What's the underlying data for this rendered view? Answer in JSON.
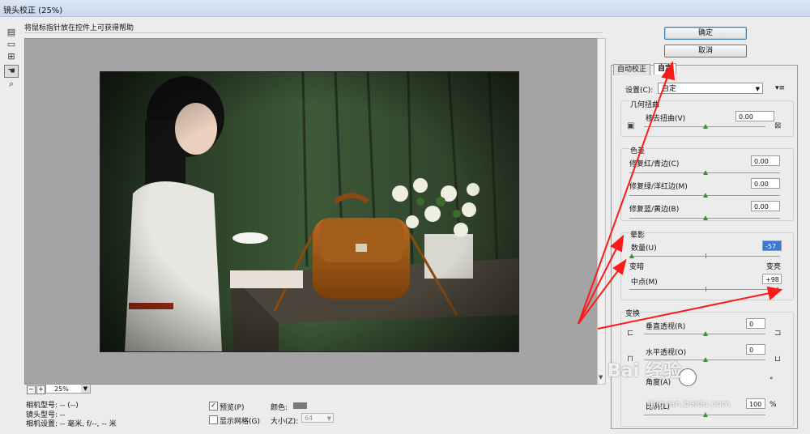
{
  "window": {
    "title": "镜头校正 (25%)"
  },
  "hint_text": "将鼠标指针放在控件上可获得帮助",
  "tools": [
    {
      "name": "remove-distortion-tool-icon",
      "glyph": "▤"
    },
    {
      "name": "straighten-tool-icon",
      "glyph": "▭"
    },
    {
      "name": "move-grid-tool-icon",
      "glyph": "⊞"
    },
    {
      "name": "hand-tool-icon",
      "glyph": "✋"
    },
    {
      "name": "zoom-tool-icon",
      "glyph": "🔍"
    }
  ],
  "zoom": {
    "minus": "−",
    "plus": "+",
    "value": "25%",
    "dropdown_glyph": "▼"
  },
  "camera_info": {
    "camera_model": "相机型号: -- (--)",
    "lens_model": "镜头型号: --",
    "camera_settings": "相机设置: -- 毫米, f/--, -- 米"
  },
  "options": {
    "preview_label": "预览(P)",
    "preview_checked": "✓",
    "show_grid_label": "显示网格(G)",
    "color_label": "颜色:",
    "color_value": "#7a7a7a",
    "size_label": "大小(Z):",
    "size_value": "64"
  },
  "buttons": {
    "ok": "确定",
    "cancel": "取消"
  },
  "tabs": {
    "auto": "自动校正",
    "custom": "自定"
  },
  "settings": {
    "label": "设置(C):",
    "value": "自定",
    "menu_glyph": "▾≡"
  },
  "geometric": {
    "title": "几何扭曲",
    "remove_distortion_label": "移去扭曲(V)",
    "remove_distortion_value": "0.00"
  },
  "chromatic": {
    "title": "色差",
    "rows": [
      {
        "label": "修复红/青边(C)",
        "value": "0.00"
      },
      {
        "label": "修复绿/洋红边(M)",
        "value": "0.00"
      },
      {
        "label": "修复蓝/黄边(B)",
        "value": "0.00"
      }
    ]
  },
  "vignette": {
    "title": "晕影",
    "amount_label": "数量(U)",
    "amount_value": "-57",
    "darken_label": "变暗",
    "lighten_label": "变亮",
    "midpoint_label": "中点(M)",
    "midpoint_value": "+98"
  },
  "transform": {
    "title": "变换",
    "vertical_label": "垂直透视(R)",
    "vertical_value": "0",
    "horizontal_label": "水平透视(O)",
    "horizontal_value": "0",
    "angle_label": "角度(A)",
    "angle_unit": "°",
    "scale_label": "比例(L)",
    "scale_value": "100",
    "scale_unit": "%"
  },
  "watermark": {
    "text": "Bai 经验",
    "url": "jingyan.baidu.com"
  },
  "accent_color": "#ff1a1a"
}
